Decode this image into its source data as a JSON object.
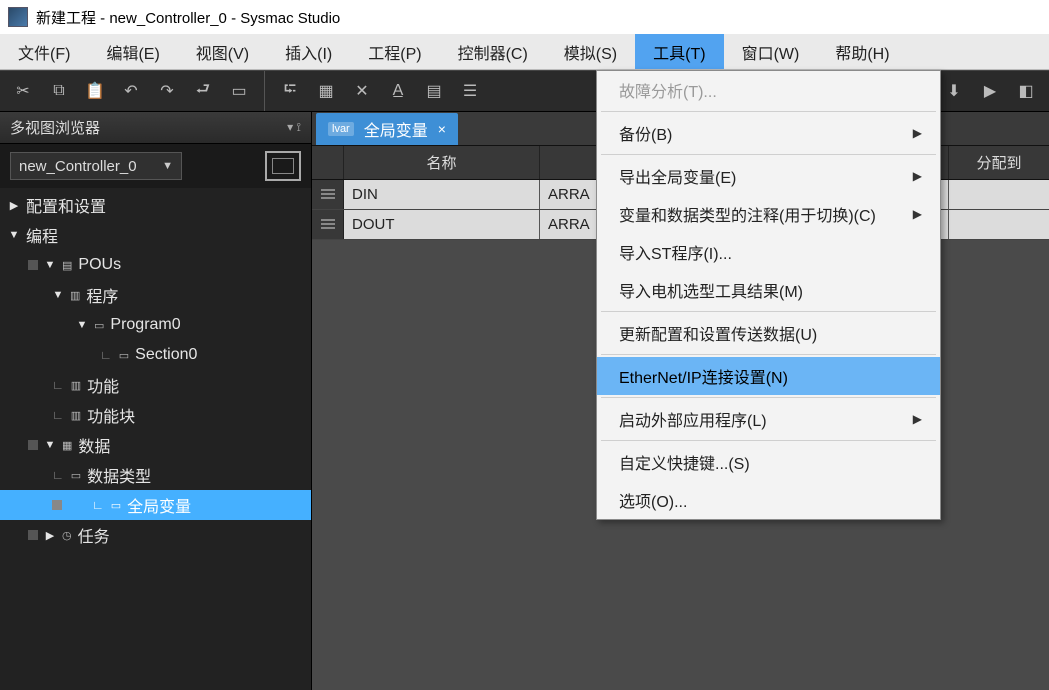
{
  "title": "新建工程 - new_Controller_0 - Sysmac Studio",
  "menubar": [
    "文件(F)",
    "编辑(E)",
    "视图(V)",
    "插入(I)",
    "工程(P)",
    "控制器(C)",
    "模拟(S)",
    "工具(T)",
    "窗口(W)",
    "帮助(H)"
  ],
  "menubar_active_index": 7,
  "sidebar": {
    "title": "多视图浏览器",
    "controller": "new_Controller_0",
    "tree": {
      "config": "配置和设置",
      "programming": "编程",
      "pous": "POUs",
      "programs": "程序",
      "program0": "Program0",
      "section0": "Section0",
      "functions": "功能",
      "function_blocks": "功能块",
      "data": "数据",
      "datatypes": "数据类型",
      "globalvars": "全局变量",
      "tasks": "任务"
    }
  },
  "tab": {
    "prefix": "lvar",
    "label": "全局变量"
  },
  "table": {
    "headers": {
      "name": "名称",
      "alloc": "分配到"
    },
    "rows": [
      {
        "name": "DIN",
        "type": "ARRA"
      },
      {
        "name": "DOUT",
        "type": "ARRA"
      }
    ]
  },
  "dropdown": {
    "items": [
      {
        "label": "故障分析(T)...",
        "disabled": true
      },
      {
        "sep": true
      },
      {
        "label": "备份(B)",
        "sub": true
      },
      {
        "sep": true
      },
      {
        "label": "导出全局变量(E)",
        "sub": true
      },
      {
        "label": "变量和数据类型的注释(用于切换)(C)",
        "sub": true
      },
      {
        "label": "导入ST程序(I)..."
      },
      {
        "label": "导入电机选型工具结果(M)"
      },
      {
        "sep": true
      },
      {
        "label": "更新配置和设置传送数据(U)"
      },
      {
        "sep": true
      },
      {
        "label": "EtherNet/IP连接设置(N)",
        "highlight": true
      },
      {
        "sep": true
      },
      {
        "label": "启动外部应用程序(L)",
        "sub": true
      },
      {
        "sep": true
      },
      {
        "label": "自定义快捷键...(S)"
      },
      {
        "label": "选项(O)..."
      }
    ]
  }
}
